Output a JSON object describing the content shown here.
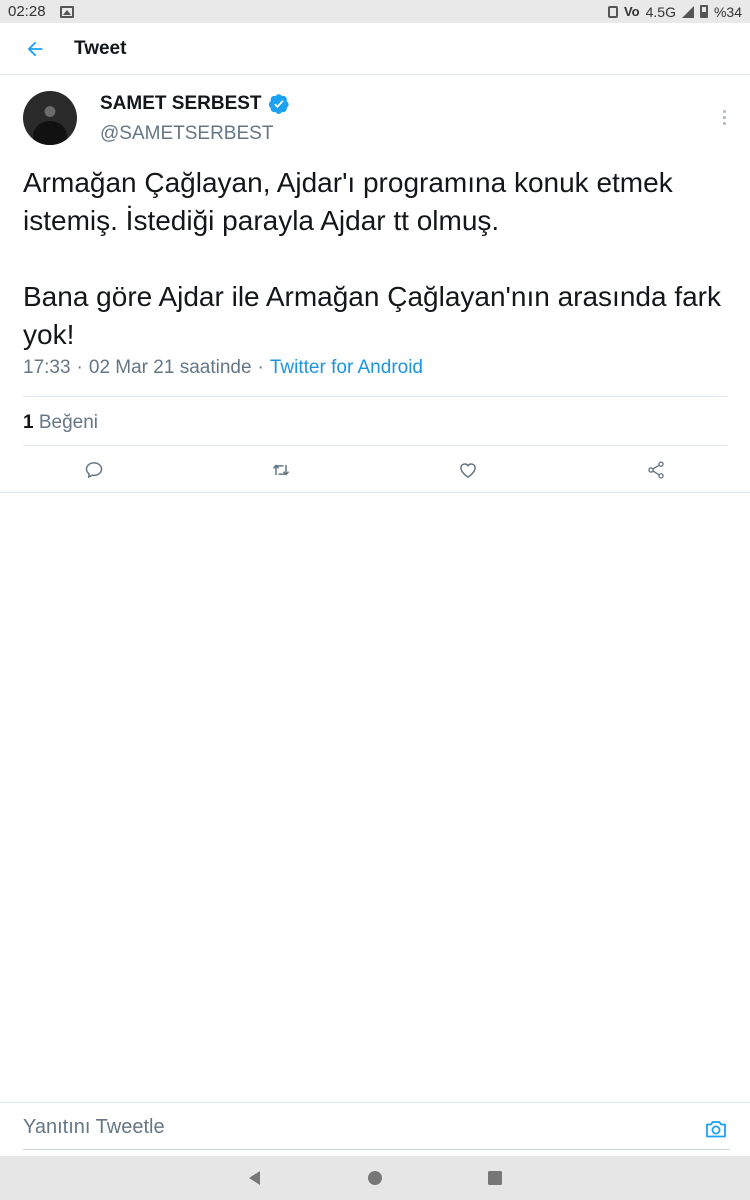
{
  "status_bar": {
    "time": "02:28",
    "network": "4.5G",
    "volte": "Vo",
    "battery": "%34"
  },
  "header": {
    "title": "Tweet"
  },
  "tweet": {
    "author_name": "SAMET SERBEST",
    "author_handle": "@SAMETSERBEST",
    "verified": true,
    "text": "Armağan Çağlayan, Ajdar'ı programına konuk etmek istemiş. İstediği parayla Ajdar tt olmuş.\n\nBana göre Ajdar ile Armağan Çağlayan'nın arasında fark yok!",
    "time": "17:33",
    "separator": "·",
    "date": "02 Mar 21 saatinde",
    "client": "Twitter for Android",
    "like_count": "1",
    "like_label": "Beğeni"
  },
  "reply": {
    "placeholder": "Yanıtını Tweetle"
  },
  "colors": {
    "accent": "#1da1f2",
    "link": "#1b95e0",
    "secondary_text": "#657786",
    "divider": "#e1e8ed"
  },
  "icons": {
    "back": "arrow-left-icon",
    "verified": "verified-badge-icon",
    "more": "more-vertical-icon",
    "reply": "reply-icon",
    "retweet": "retweet-icon",
    "like": "heart-icon",
    "share": "share-icon",
    "camera": "camera-icon",
    "nav_back": "nav-back-icon",
    "nav_home": "nav-home-icon",
    "nav_recents": "nav-recents-icon"
  }
}
